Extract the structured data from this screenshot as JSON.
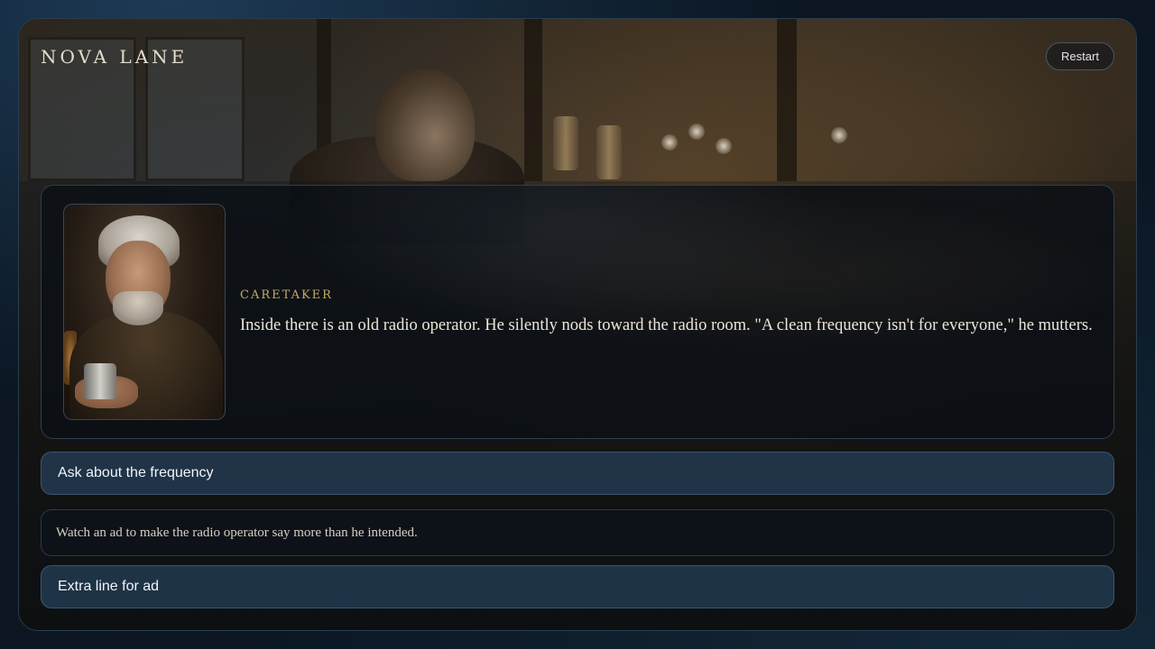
{
  "header": {
    "title": "NOVA LANE",
    "restart_label": "Restart"
  },
  "scene": {
    "background": "radio-room-painting"
  },
  "dialogue": {
    "portrait": "caretaker-portrait",
    "speaker": "CARETAKER",
    "text": "Inside there is an old radio operator. He silently nods toward the radio room. \"A clean frequency isn't for everyone,\" he mutters."
  },
  "choices": [
    {
      "label": "Ask about the frequency"
    },
    {
      "label": "Extra line for ad"
    }
  ],
  "ad_prompt": {
    "text": "Watch an ad to make the radio operator say more than he intended."
  },
  "colors": {
    "accent_gold": "#c9a961",
    "choice_bg": "#22384e",
    "panel_bg": "#0c1016",
    "page_bg": "#0b1622"
  }
}
